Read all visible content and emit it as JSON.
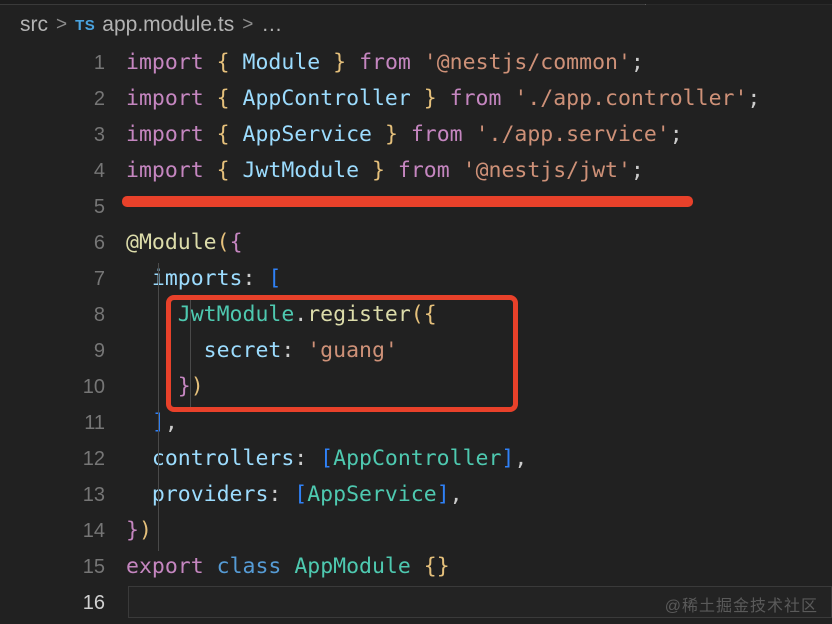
{
  "window": {
    "theme_background": "#212121",
    "accent_annotation_color": "#e8412a"
  },
  "breadcrumb": {
    "folder": "src",
    "separator": ">",
    "file_icon_label": "TS",
    "file": "app.module.ts",
    "trailing": "…"
  },
  "editor": {
    "active_line_number": 16,
    "lines": [
      {
        "number": "1",
        "tokens": [
          {
            "t": "import",
            "c": "kw"
          },
          {
            "t": " ",
            "c": "punc"
          },
          {
            "t": "{",
            "c": "brace"
          },
          {
            "t": " ",
            "c": "punc"
          },
          {
            "t": "Module",
            "c": "ident"
          },
          {
            "t": " ",
            "c": "punc"
          },
          {
            "t": "}",
            "c": "brace"
          },
          {
            "t": " ",
            "c": "punc"
          },
          {
            "t": "from",
            "c": "kw"
          },
          {
            "t": " ",
            "c": "punc"
          },
          {
            "t": "'@nestjs/common'",
            "c": "str"
          },
          {
            "t": ";",
            "c": "punc"
          }
        ]
      },
      {
        "number": "2",
        "tokens": [
          {
            "t": "import",
            "c": "kw"
          },
          {
            "t": " ",
            "c": "punc"
          },
          {
            "t": "{",
            "c": "brace"
          },
          {
            "t": " ",
            "c": "punc"
          },
          {
            "t": "AppController",
            "c": "ident"
          },
          {
            "t": " ",
            "c": "punc"
          },
          {
            "t": "}",
            "c": "brace"
          },
          {
            "t": " ",
            "c": "punc"
          },
          {
            "t": "from",
            "c": "kw"
          },
          {
            "t": " ",
            "c": "punc"
          },
          {
            "t": "'./app.controller'",
            "c": "str"
          },
          {
            "t": ";",
            "c": "punc"
          }
        ]
      },
      {
        "number": "3",
        "tokens": [
          {
            "t": "import",
            "c": "kw"
          },
          {
            "t": " ",
            "c": "punc"
          },
          {
            "t": "{",
            "c": "brace"
          },
          {
            "t": " ",
            "c": "punc"
          },
          {
            "t": "AppService",
            "c": "ident"
          },
          {
            "t": " ",
            "c": "punc"
          },
          {
            "t": "}",
            "c": "brace"
          },
          {
            "t": " ",
            "c": "punc"
          },
          {
            "t": "from",
            "c": "kw"
          },
          {
            "t": " ",
            "c": "punc"
          },
          {
            "t": "'./app.service'",
            "c": "str"
          },
          {
            "t": ";",
            "c": "punc"
          }
        ]
      },
      {
        "number": "4",
        "tokens": [
          {
            "t": "import",
            "c": "kw"
          },
          {
            "t": " ",
            "c": "punc"
          },
          {
            "t": "{",
            "c": "brace"
          },
          {
            "t": " ",
            "c": "punc"
          },
          {
            "t": "JwtModule",
            "c": "ident"
          },
          {
            "t": " ",
            "c": "punc"
          },
          {
            "t": "}",
            "c": "brace"
          },
          {
            "t": " ",
            "c": "punc"
          },
          {
            "t": "from",
            "c": "kw"
          },
          {
            "t": " ",
            "c": "punc"
          },
          {
            "t": "'@nestjs/jwt'",
            "c": "str"
          },
          {
            "t": ";",
            "c": "punc"
          }
        ]
      },
      {
        "number": "5",
        "tokens": []
      },
      {
        "number": "6",
        "tokens": [
          {
            "t": "@Module",
            "c": "deco"
          },
          {
            "t": "(",
            "c": "paren"
          },
          {
            "t": "{",
            "c": "brace-p"
          }
        ]
      },
      {
        "number": "7",
        "tokens": [
          {
            "t": "  ",
            "c": "punc"
          },
          {
            "t": "imports",
            "c": "ident"
          },
          {
            "t": ": ",
            "c": "punc"
          },
          {
            "t": "[",
            "c": "bracket"
          }
        ]
      },
      {
        "number": "8",
        "tokens": [
          {
            "t": "    ",
            "c": "punc"
          },
          {
            "t": "JwtModule",
            "c": "cls"
          },
          {
            "t": ".",
            "c": "punc"
          },
          {
            "t": "register",
            "c": "deco"
          },
          {
            "t": "(",
            "c": "paren"
          },
          {
            "t": "{",
            "c": "brace"
          }
        ]
      },
      {
        "number": "9",
        "tokens": [
          {
            "t": "      ",
            "c": "punc"
          },
          {
            "t": "secret",
            "c": "ident"
          },
          {
            "t": ": ",
            "c": "punc"
          },
          {
            "t": "'guang'",
            "c": "str"
          }
        ]
      },
      {
        "number": "10",
        "tokens": [
          {
            "t": "    ",
            "c": "punc"
          },
          {
            "t": "}",
            "c": "brace-p"
          },
          {
            "t": ")",
            "c": "paren"
          }
        ]
      },
      {
        "number": "11",
        "tokens": [
          {
            "t": "  ",
            "c": "punc"
          },
          {
            "t": "]",
            "c": "bracket"
          },
          {
            "t": ",",
            "c": "punc"
          }
        ]
      },
      {
        "number": "12",
        "tokens": [
          {
            "t": "  ",
            "c": "punc"
          },
          {
            "t": "controllers",
            "c": "ident"
          },
          {
            "t": ": ",
            "c": "punc"
          },
          {
            "t": "[",
            "c": "bracket"
          },
          {
            "t": "AppController",
            "c": "cls"
          },
          {
            "t": "]",
            "c": "bracket"
          },
          {
            "t": ",",
            "c": "punc"
          }
        ]
      },
      {
        "number": "13",
        "tokens": [
          {
            "t": "  ",
            "c": "punc"
          },
          {
            "t": "providers",
            "c": "ident"
          },
          {
            "t": ": ",
            "c": "punc"
          },
          {
            "t": "[",
            "c": "bracket"
          },
          {
            "t": "AppService",
            "c": "cls"
          },
          {
            "t": "]",
            "c": "bracket"
          },
          {
            "t": ",",
            "c": "punc"
          }
        ]
      },
      {
        "number": "14",
        "tokens": [
          {
            "t": "}",
            "c": "brace-p"
          },
          {
            "t": ")",
            "c": "paren"
          }
        ]
      },
      {
        "number": "15",
        "tokens": [
          {
            "t": "export",
            "c": "kw"
          },
          {
            "t": " ",
            "c": "punc"
          },
          {
            "t": "class",
            "c": "kw2"
          },
          {
            "t": " ",
            "c": "punc"
          },
          {
            "t": "AppModule",
            "c": "cls"
          },
          {
            "t": " ",
            "c": "punc"
          },
          {
            "t": "{}",
            "c": "brace"
          }
        ]
      },
      {
        "number": "16",
        "tokens": [],
        "active": true
      }
    ]
  },
  "annotations": [
    {
      "name": "red-underline-import-jwtmodule",
      "type": "underline",
      "color": "#e8412a"
    },
    {
      "name": "red-box-jwtmodule-register",
      "type": "rectangle",
      "color": "#e8412a"
    }
  ],
  "watermark": {
    "text": "@稀土掘金技术社区"
  }
}
